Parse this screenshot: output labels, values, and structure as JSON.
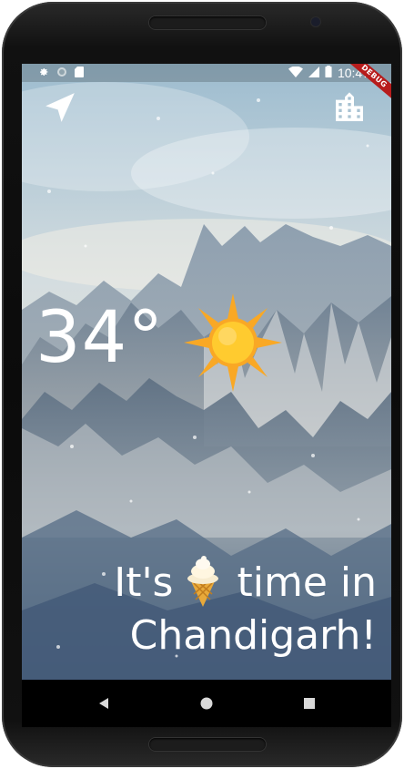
{
  "status_bar": {
    "time": "10:47",
    "left_icons": [
      "settings-icon",
      "sync-circle-icon",
      "sd-card-icon"
    ],
    "right_icons": [
      "wifi-icon",
      "signal-icon",
      "battery-icon"
    ]
  },
  "debug_banner": "DEBUG",
  "top_bar": {
    "left_icon": "location-arrow-icon",
    "right_icon": "city-icon"
  },
  "weather": {
    "temperature": "34°",
    "condition_icon": "sun-icon"
  },
  "message": {
    "line1_prefix": "It's",
    "line1_icon": "ice-cream-icon",
    "line1_suffix": "time in",
    "line2": "Chandigarh!"
  },
  "nav_bar": {
    "back_icon": "back-icon",
    "home_icon": "home-icon",
    "recents_icon": "recents-icon"
  },
  "colors": {
    "text": "#ffffff",
    "sun_core": "#ffcb2f",
    "sun_rays": "#f9a825",
    "debug_banner": "#b71c1c"
  }
}
